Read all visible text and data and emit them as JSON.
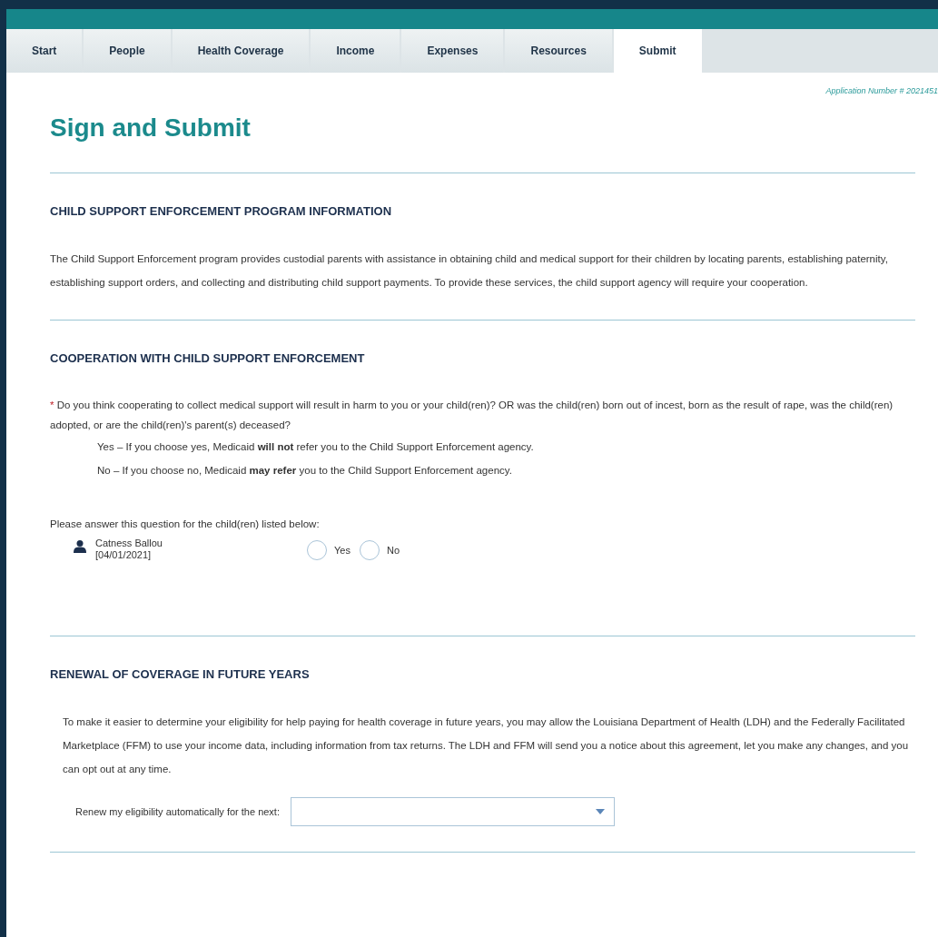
{
  "tabs": [
    {
      "label": "Start",
      "selected": false
    },
    {
      "label": "People",
      "selected": false
    },
    {
      "label": "Health Coverage",
      "selected": false
    },
    {
      "label": "Income",
      "selected": false
    },
    {
      "label": "Expenses",
      "selected": false
    },
    {
      "label": "Resources",
      "selected": false
    },
    {
      "label": "Submit",
      "selected": true
    }
  ],
  "application_number": "Application Number # 2021451",
  "page_title": "Sign and Submit",
  "sections": [
    {
      "heading": "CHILD SUPPORT ENFORCEMENT PROGRAM INFORMATION",
      "paragraph": "The Child Support Enforcement program provides custodial parents with assistance in obtaining child and medical support for their children by locating parents, establishing paternity, establishing support orders, and collecting and distributing child support payments. To provide these services, the child support agency will require your cooperation."
    },
    {
      "heading": "COOPERATION WITH CHILD SUPPORT ENFORCEMENT",
      "required_mark": "*",
      "question": "Do you think cooperating to collect medical support will result in harm to you or your child(ren)? OR was the child(ren) born out of incest, born as the result of rape, was the child(ren) adopted, or are the child(ren)'s parent(s) deceased?",
      "notes": [
        "Yes – If you choose yes, Medicaid **will not** refer you to the Child Support Enforcement agency.",
        "No – If you choose no, Medicaid **may refer** you to the Child Support Enforcement agency."
      ],
      "prompt": "Please answer this question for the child(ren) listed below:",
      "children_list": [
        {
          "name": "Catness Ballou",
          "birth_date": "[04/01/2021]",
          "options": [
            {
              "label": "Yes",
              "selected": false
            },
            {
              "label": "No",
              "selected": false
            }
          ]
        }
      ]
    },
    {
      "heading": "RENEWAL OF COVERAGE IN FUTURE YEARS",
      "paragraph": "To make it easier to determine your eligibility for help paying for health coverage in future years, you may allow the Louisiana Department of Health (LDH) and the Federally Facilitated Marketplace (FFM) to use your income data, including information from tax returns. The LDH and FFM will send you a notice about this agreement, let you make any changes, and you can opt out at any time.",
      "select_label": "Renew my eligibility automatically for the next:"
    }
  ]
}
